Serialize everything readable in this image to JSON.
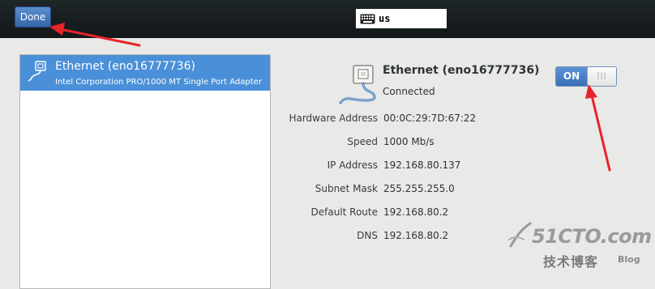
{
  "header": {
    "done_label": "Done",
    "keyboard_layout": "us"
  },
  "device_list": {
    "items": [
      {
        "name": "Ethernet (eno16777736)",
        "description": "Intel Corporation PRO/1000 MT Single Port Adapter",
        "selected": true
      }
    ]
  },
  "details": {
    "name": "Ethernet (eno16777736)",
    "status": "Connected",
    "toggle_label": "ON",
    "toggle_state": true,
    "properties": [
      {
        "label": "Hardware Address",
        "value": "00:0C:29:7D:67:22"
      },
      {
        "label": "Speed",
        "value": "1000 Mb/s"
      },
      {
        "label": "IP Address",
        "value": "192.168.80.137"
      },
      {
        "label": "Subnet Mask",
        "value": "255.255.255.0"
      },
      {
        "label": "Default Route",
        "value": "192.168.80.2"
      },
      {
        "label": "DNS",
        "value": "192.168.80.2"
      }
    ]
  },
  "watermark": {
    "site": "51CTO.com",
    "chinese": "技术博客",
    "blog": "Blog"
  },
  "colors": {
    "accent": "#4a90d9",
    "annotation_arrow": "#e8242a",
    "header_bg": "#1a2123"
  }
}
